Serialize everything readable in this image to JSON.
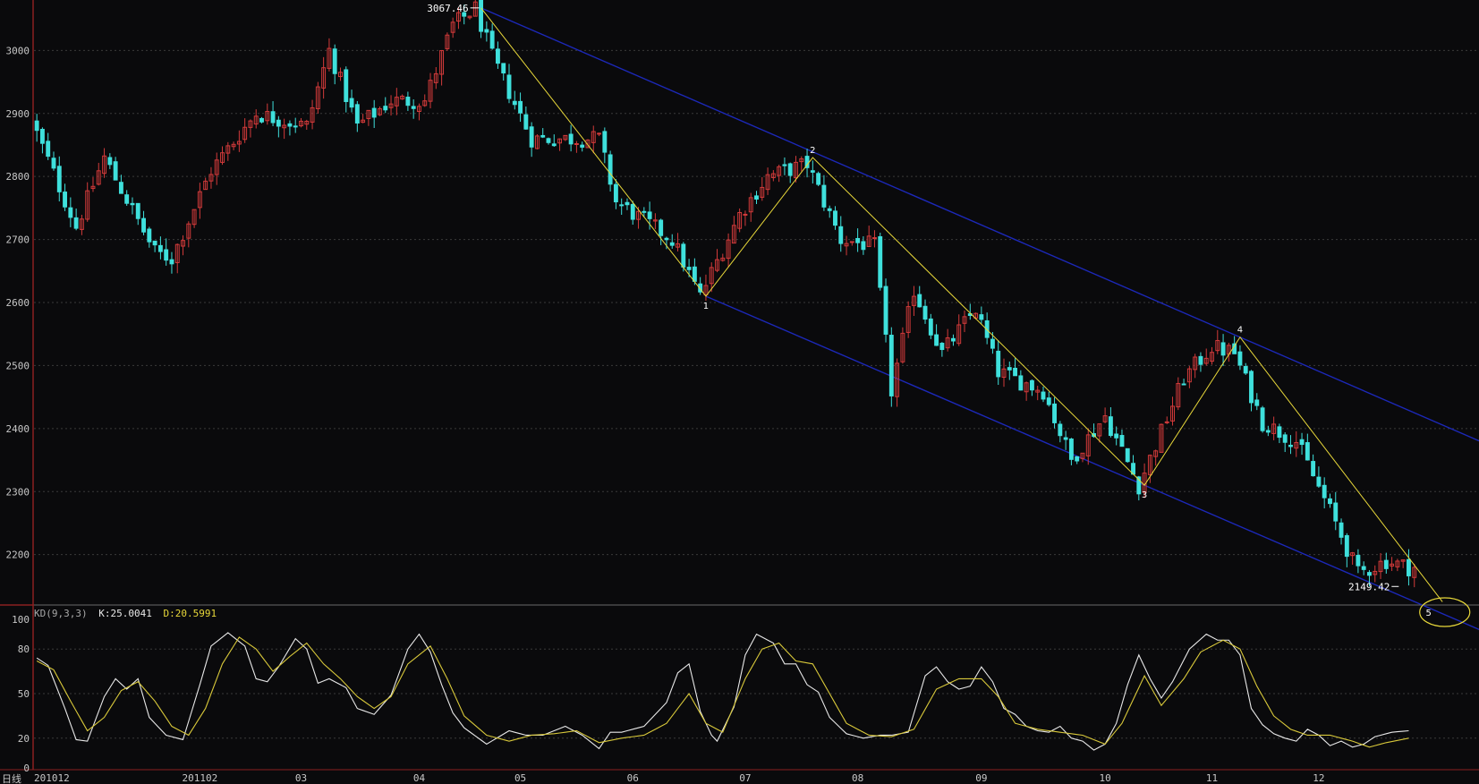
{
  "chart_data": [
    {
      "type": "candlestick",
      "ylim": [
        2120,
        3080
      ],
      "yticks": [
        3000,
        2900,
        2800,
        2700,
        2600,
        2500,
        2400,
        2300,
        2200
      ],
      "x_labels": [
        "201012",
        "201102",
        "03",
        "04",
        "05",
        "06",
        "07",
        "08",
        "09",
        "10",
        "11",
        "12"
      ],
      "x_label_index": [
        0,
        29,
        47,
        68,
        86,
        106,
        126,
        146,
        168,
        190,
        209,
        228
      ],
      "total_index": 257,
      "grid": true,
      "colors": {
        "up": "#d23a3a",
        "down": "#3fe0dc",
        "zigzag": "#e8d83a",
        "channel": "#1c28b8"
      },
      "candle_count": 246,
      "anchors": [
        [
          0,
          2890
        ],
        [
          8,
          2720
        ],
        [
          13,
          2830
        ],
        [
          22,
          2680
        ],
        [
          25,
          2670
        ],
        [
          32,
          2810
        ],
        [
          40,
          2900
        ],
        [
          49,
          2880
        ],
        [
          53,
          3000
        ],
        [
          58,
          2880
        ],
        [
          64,
          2920
        ],
        [
          70,
          2920
        ],
        [
          75,
          3040
        ],
        [
          79,
          3067
        ],
        [
          82,
          2990
        ],
        [
          89,
          2860
        ],
        [
          97,
          2860
        ],
        [
          101,
          2860
        ],
        [
          104,
          2760
        ],
        [
          114,
          2700
        ],
        [
          119,
          2610
        ],
        [
          126,
          2740
        ],
        [
          131,
          2800
        ],
        [
          138,
          2820
        ],
        [
          144,
          2700
        ],
        [
          150,
          2690
        ],
        [
          153,
          2460
        ],
        [
          157,
          2620
        ],
        [
          162,
          2520
        ],
        [
          168,
          2590
        ],
        [
          172,
          2490
        ],
        [
          180,
          2460
        ],
        [
          185,
          2350
        ],
        [
          191,
          2420
        ],
        [
          197,
          2310
        ],
        [
          205,
          2480
        ],
        [
          210,
          2530
        ],
        [
          214,
          2520
        ],
        [
          219,
          2410
        ],
        [
          225,
          2380
        ],
        [
          231,
          2270
        ],
        [
          236,
          2170
        ],
        [
          241,
          2190
        ],
        [
          245,
          2180
        ]
      ],
      "pivots": [
        {
          "label": "",
          "index": 79,
          "value": 3067.46
        },
        {
          "label": "1",
          "index": 119,
          "value": 2610
        },
        {
          "label": "2",
          "index": 138,
          "value": 2830
        },
        {
          "label": "3",
          "index": 197,
          "value": 2310
        },
        {
          "label": "4",
          "index": 214,
          "value": 2545
        },
        {
          "label": "5",
          "index": 245,
          "value": 2150
        }
      ],
      "target_point": {
        "label": "5",
        "index": 245,
        "value": 2130
      },
      "annotations": [
        {
          "text": "3067.46",
          "index": 79,
          "value": 3067.46
        },
        {
          "text": "2149.42",
          "index": 240,
          "value": 2149.42
        }
      ],
      "channel_upper": {
        "p1": [
          79,
          3067.46
        ],
        "p2": [
          214,
          2545
        ]
      },
      "channel_lower": {
        "p1": [
          119,
          2610
        ],
        "p2": [
          197,
          2310
        ]
      }
    },
    {
      "type": "line",
      "indicator": "KD(9,3,3)",
      "k_value": "K:25.0041",
      "d_value": "D:20.5991",
      "ylim": [
        0,
        100
      ],
      "yticks": [
        100,
        80,
        50,
        20,
        0
      ],
      "series": [
        {
          "name": "K",
          "color": "#e8e8e8",
          "anchors": [
            [
              0,
              74
            ],
            [
              2,
              69
            ],
            [
              5,
              40
            ],
            [
              7,
              19
            ],
            [
              9,
              18
            ],
            [
              12,
              48
            ],
            [
              14,
              60
            ],
            [
              16,
              53
            ],
            [
              18,
              60
            ],
            [
              20,
              34
            ],
            [
              23,
              22
            ],
            [
              26,
              19
            ],
            [
              29,
              56
            ],
            [
              31,
              82
            ],
            [
              34,
              91
            ],
            [
              37,
              82
            ],
            [
              39,
              60
            ],
            [
              41,
              58
            ],
            [
              43,
              68
            ],
            [
              46,
              87
            ],
            [
              48,
              80
            ],
            [
              50,
              57
            ],
            [
              52,
              60
            ],
            [
              55,
              54
            ],
            [
              57,
              40
            ],
            [
              60,
              36
            ],
            [
              63,
              49
            ],
            [
              66,
              80
            ],
            [
              68,
              90
            ],
            [
              70,
              78
            ],
            [
              72,
              56
            ],
            [
              74,
              37
            ],
            [
              76,
              27
            ],
            [
              80,
              16
            ],
            [
              84,
              25
            ],
            [
              87,
              22
            ],
            [
              90,
              22
            ],
            [
              94,
              28
            ],
            [
              97,
              22
            ],
            [
              100,
              13
            ],
            [
              102,
              24
            ],
            [
              104,
              24
            ],
            [
              108,
              28
            ],
            [
              112,
              44
            ],
            [
              114,
              64
            ],
            [
              116,
              70
            ],
            [
              118,
              38
            ],
            [
              120,
              22
            ],
            [
              121,
              18
            ],
            [
              124,
              41
            ],
            [
              126,
              76
            ],
            [
              128,
              90
            ],
            [
              131,
              84
            ],
            [
              133,
              70
            ],
            [
              135,
              70
            ],
            [
              137,
              56
            ],
            [
              139,
              51
            ],
            [
              141,
              34
            ],
            [
              144,
              23
            ],
            [
              147,
              20
            ],
            [
              150,
              22
            ],
            [
              152,
              22
            ],
            [
              155,
              24
            ],
            [
              158,
              62
            ],
            [
              160,
              68
            ],
            [
              162,
              58
            ],
            [
              164,
              53
            ],
            [
              166,
              55
            ],
            [
              168,
              68
            ],
            [
              170,
              58
            ],
            [
              172,
              40
            ],
            [
              174,
              36
            ],
            [
              176,
              28
            ],
            [
              178,
              25
            ],
            [
              180,
              24
            ],
            [
              182,
              28
            ],
            [
              184,
              20
            ],
            [
              186,
              18
            ],
            [
              188,
              12
            ],
            [
              190,
              16
            ],
            [
              192,
              30
            ],
            [
              194,
              56
            ],
            [
              196,
              76
            ],
            [
              198,
              60
            ],
            [
              200,
              47
            ],
            [
              202,
              58
            ],
            [
              205,
              80
            ],
            [
              208,
              90
            ],
            [
              210,
              86
            ],
            [
              212,
              86
            ],
            [
              214,
              76
            ],
            [
              216,
              40
            ],
            [
              218,
              29
            ],
            [
              220,
              23
            ],
            [
              222,
              20
            ],
            [
              224,
              18
            ],
            [
              226,
              26
            ],
            [
              228,
              22
            ],
            [
              230,
              15
            ],
            [
              232,
              18
            ],
            [
              234,
              14
            ],
            [
              236,
              16
            ],
            [
              238,
              21
            ],
            [
              241,
              24
            ],
            [
              244,
              25
            ]
          ]
        },
        {
          "name": "D",
          "color": "#d8c83a",
          "anchors": [
            [
              0,
              72
            ],
            [
              3,
              66
            ],
            [
              6,
              45
            ],
            [
              9,
              25
            ],
            [
              12,
              34
            ],
            [
              15,
              52
            ],
            [
              18,
              58
            ],
            [
              21,
              45
            ],
            [
              24,
              28
            ],
            [
              27,
              22
            ],
            [
              30,
              40
            ],
            [
              33,
              70
            ],
            [
              36,
              88
            ],
            [
              39,
              80
            ],
            [
              42,
              65
            ],
            [
              45,
              75
            ],
            [
              48,
              84
            ],
            [
              51,
              70
            ],
            [
              54,
              60
            ],
            [
              57,
              48
            ],
            [
              60,
              40
            ],
            [
              63,
              48
            ],
            [
              66,
              70
            ],
            [
              70,
              82
            ],
            [
              73,
              60
            ],
            [
              76,
              35
            ],
            [
              80,
              22
            ],
            [
              84,
              18
            ],
            [
              88,
              22
            ],
            [
              92,
              23
            ],
            [
              96,
              25
            ],
            [
              100,
              17
            ],
            [
              104,
              20
            ],
            [
              108,
              22
            ],
            [
              112,
              30
            ],
            [
              116,
              50
            ],
            [
              119,
              30
            ],
            [
              122,
              24
            ],
            [
              126,
              60
            ],
            [
              129,
              80
            ],
            [
              132,
              84
            ],
            [
              135,
              72
            ],
            [
              138,
              70
            ],
            [
              141,
              50
            ],
            [
              144,
              30
            ],
            [
              148,
              22
            ],
            [
              152,
              21
            ],
            [
              156,
              26
            ],
            [
              160,
              53
            ],
            [
              164,
              60
            ],
            [
              168,
              60
            ],
            [
              171,
              48
            ],
            [
              174,
              30
            ],
            [
              178,
              26
            ],
            [
              182,
              24
            ],
            [
              186,
              22
            ],
            [
              190,
              16
            ],
            [
              193,
              30
            ],
            [
              197,
              62
            ],
            [
              200,
              42
            ],
            [
              204,
              60
            ],
            [
              207,
              78
            ],
            [
              211,
              86
            ],
            [
              214,
              80
            ],
            [
              217,
              55
            ],
            [
              220,
              35
            ],
            [
              223,
              26
            ],
            [
              226,
              22
            ],
            [
              230,
              22
            ],
            [
              234,
              18
            ],
            [
              237,
              14
            ],
            [
              240,
              17
            ],
            [
              244,
              20
            ]
          ]
        }
      ]
    }
  ],
  "bottom_label": "日线"
}
